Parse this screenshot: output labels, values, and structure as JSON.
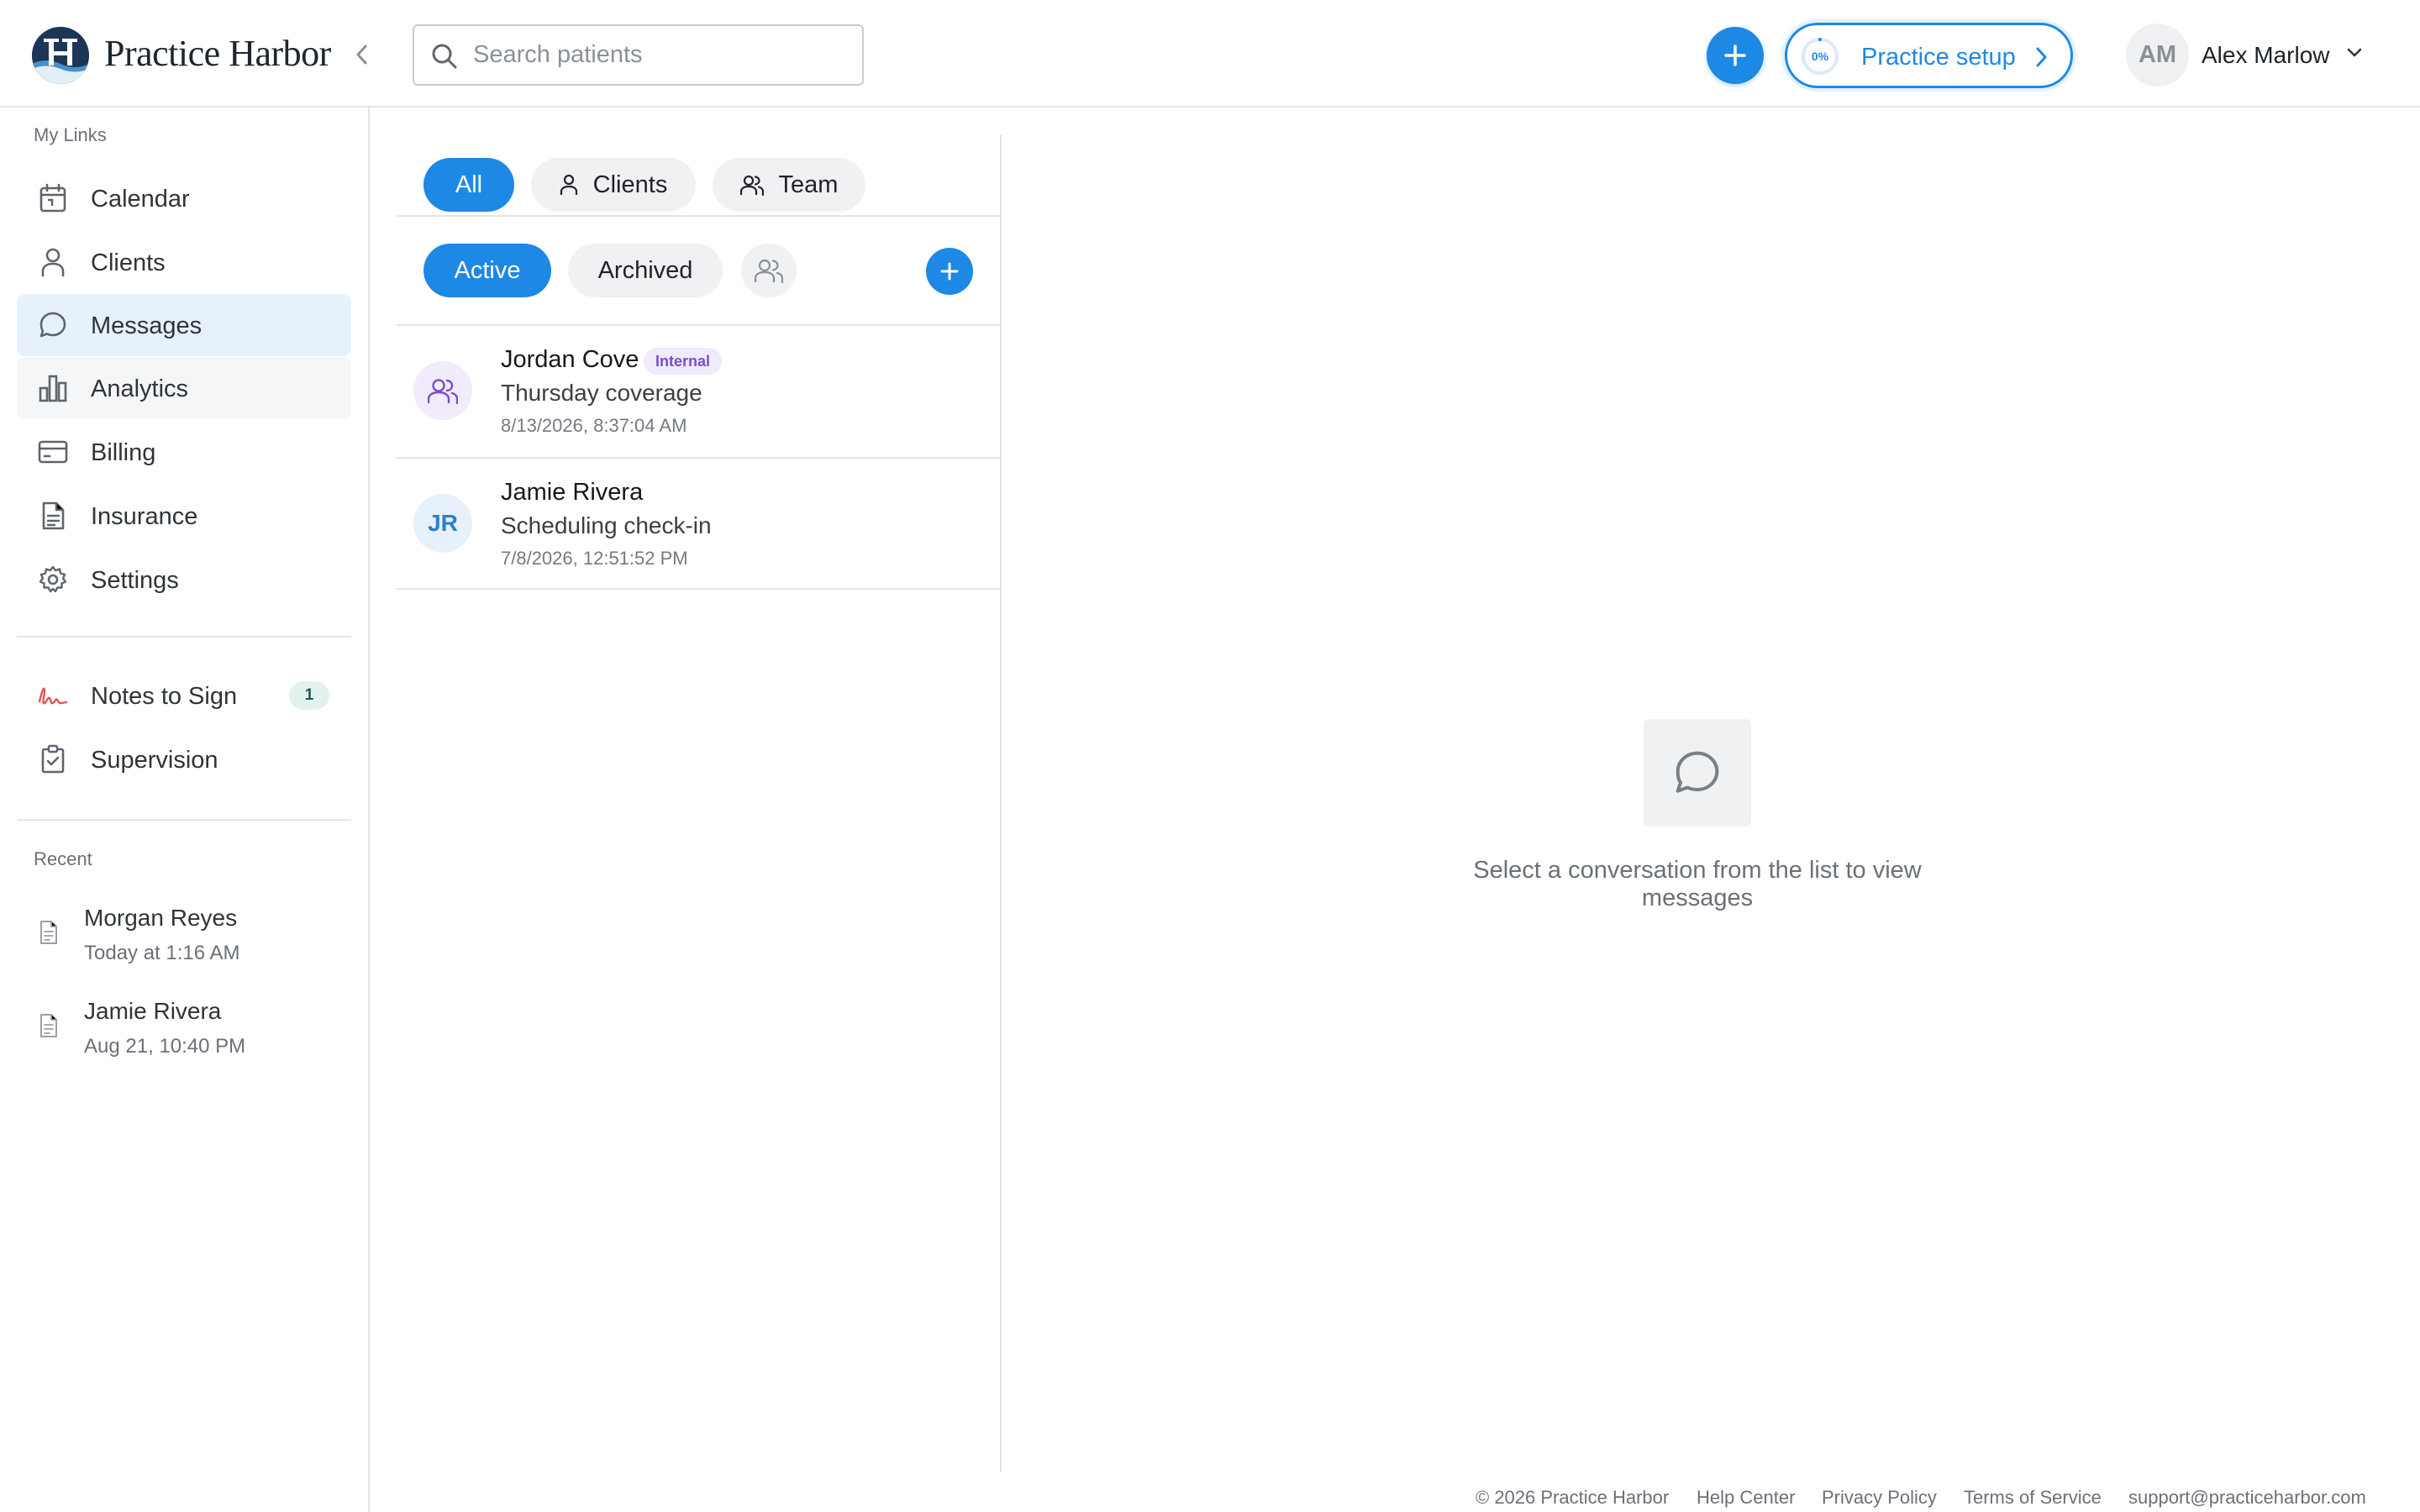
{
  "header": {
    "brand": "Practice Harbor",
    "search_placeholder": "Search patients",
    "setup_progress": "0%",
    "setup_label": "Practice setup",
    "user_initials": "AM",
    "user_name": "Alex Marlow",
    "accent_color": "#1e88e5"
  },
  "sidebar": {
    "my_links_label": "My Links",
    "items": [
      {
        "label": "Calendar",
        "icon": "calendar-icon"
      },
      {
        "label": "Clients",
        "icon": "person-icon"
      },
      {
        "label": "Messages",
        "icon": "chat-bubble-icon",
        "active": true
      },
      {
        "label": "Analytics",
        "icon": "bar-chart-icon"
      },
      {
        "label": "Billing",
        "icon": "credit-card-icon"
      },
      {
        "label": "Insurance",
        "icon": "document-icon"
      },
      {
        "label": "Settings",
        "icon": "gear-icon"
      }
    ],
    "tasks": [
      {
        "label": "Notes to Sign",
        "icon": "signature-icon",
        "count": "1"
      },
      {
        "label": "Supervision",
        "icon": "clipboard-check-icon"
      }
    ],
    "recent_label": "Recent",
    "recent": [
      {
        "name": "Morgan Reyes",
        "time": "Today at 1:16 AM"
      },
      {
        "name": "Jamie Rivera",
        "time": "Aug 21, 10:40 PM"
      }
    ]
  },
  "messages": {
    "type_filters": [
      "All",
      "Clients",
      "Team"
    ],
    "status_filters": [
      "Active",
      "Archived"
    ],
    "conversations": [
      {
        "name": "Jordan Cove",
        "tag": "Internal",
        "subject": "Thursday coverage",
        "time": "8/13/2026, 8:37:04 AM",
        "avatar": "group-icon"
      },
      {
        "name": "Jamie Rivera",
        "tag": "",
        "subject": "Scheduling check-in",
        "time": "7/8/2026, 12:51:52 PM",
        "initials": "JR"
      }
    ],
    "empty_state": "Select a conversation from the list to view messages"
  },
  "footer": {
    "copyright": "© 2026 Practice Harbor",
    "help": "Help Center",
    "privacy": "Privacy Policy",
    "terms": "Terms of Service",
    "email": "support@practiceharbor.com"
  }
}
